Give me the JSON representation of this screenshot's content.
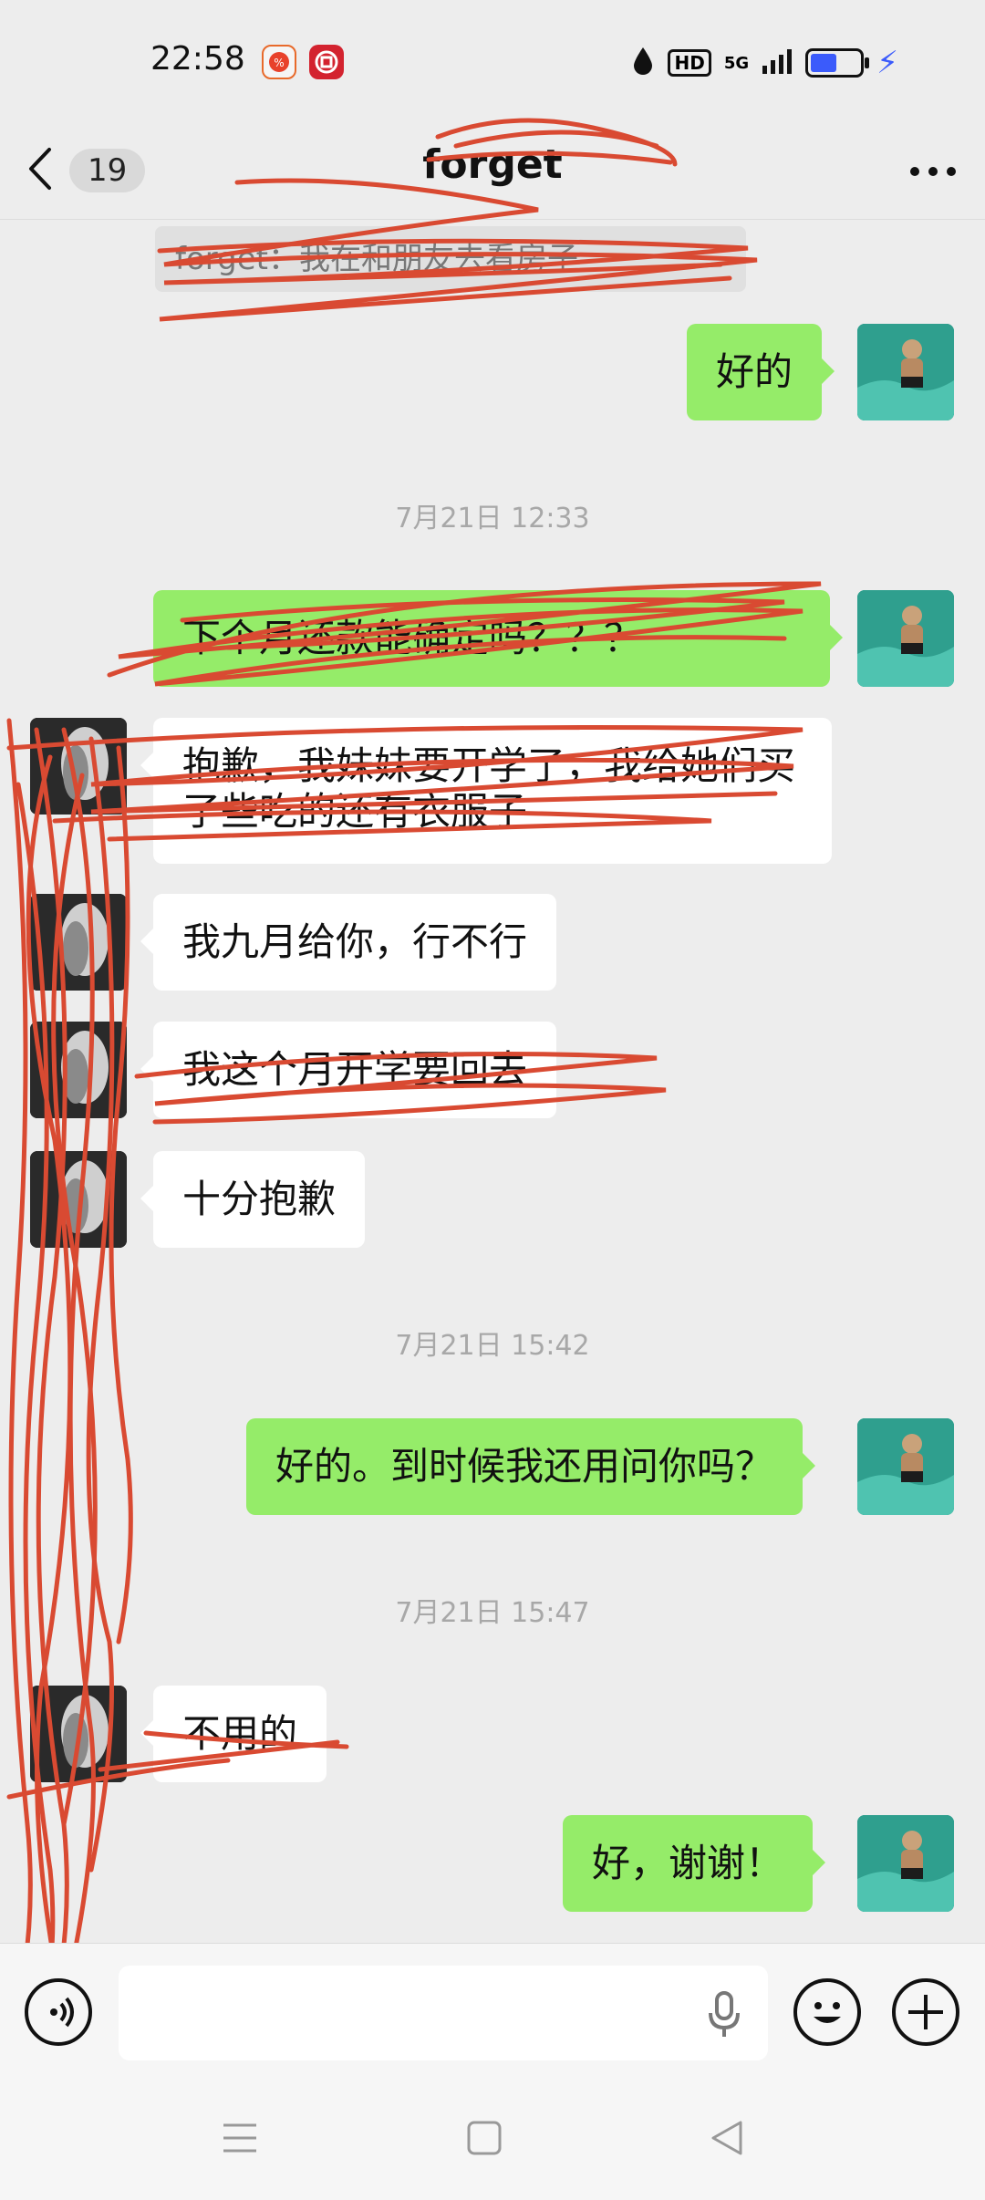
{
  "status_bar": {
    "time": "22:58",
    "hd_label": "HD",
    "network_label": "5G",
    "icons": [
      "app-notification-icon",
      "bank-app-icon",
      "drop-icon",
      "signal-icon",
      "battery-icon",
      "charging-icon"
    ]
  },
  "header": {
    "back_icon": "chevron-left-icon",
    "unread_count": "19",
    "title": "forget",
    "more_icon": "more-dots-icon"
  },
  "quote": {
    "text": "forget：我在和朋友去看房子"
  },
  "timestamps": [
    "7月21日 12:33",
    "7月21日 15:42",
    "7月21日 15:47"
  ],
  "messages": [
    {
      "from": "me",
      "text": "好的"
    },
    {
      "from": "me",
      "text": "下个月还款能确定吗？？？"
    },
    {
      "from": "other",
      "text": "抱歉，我妹妹要开学了，我给她们买了些吃的还有衣服子"
    },
    {
      "from": "other",
      "text": "我九月给你，行不行"
    },
    {
      "from": "other",
      "text": "我这个月开学要回去"
    },
    {
      "from": "other",
      "text": "十分抱歉"
    },
    {
      "from": "me",
      "text": "好的。到时候我还用问你吗？"
    },
    {
      "from": "other",
      "text": "不用的"
    },
    {
      "from": "me",
      "text": "好，谢谢！"
    }
  ],
  "input_bar": {
    "voice_icon": "voice-mode-icon",
    "mic_icon": "microphone-icon",
    "emoji_icon": "emoji-icon",
    "plus_icon": "plus-icon"
  },
  "nav_bar": {
    "icons": [
      "menu-icon",
      "home-square-icon",
      "back-triangle-icon"
    ]
  },
  "colors": {
    "my_bubble": "#95ec69",
    "other_bubble": "#ffffff",
    "background": "#ededed",
    "scribble": "#d94a32"
  }
}
